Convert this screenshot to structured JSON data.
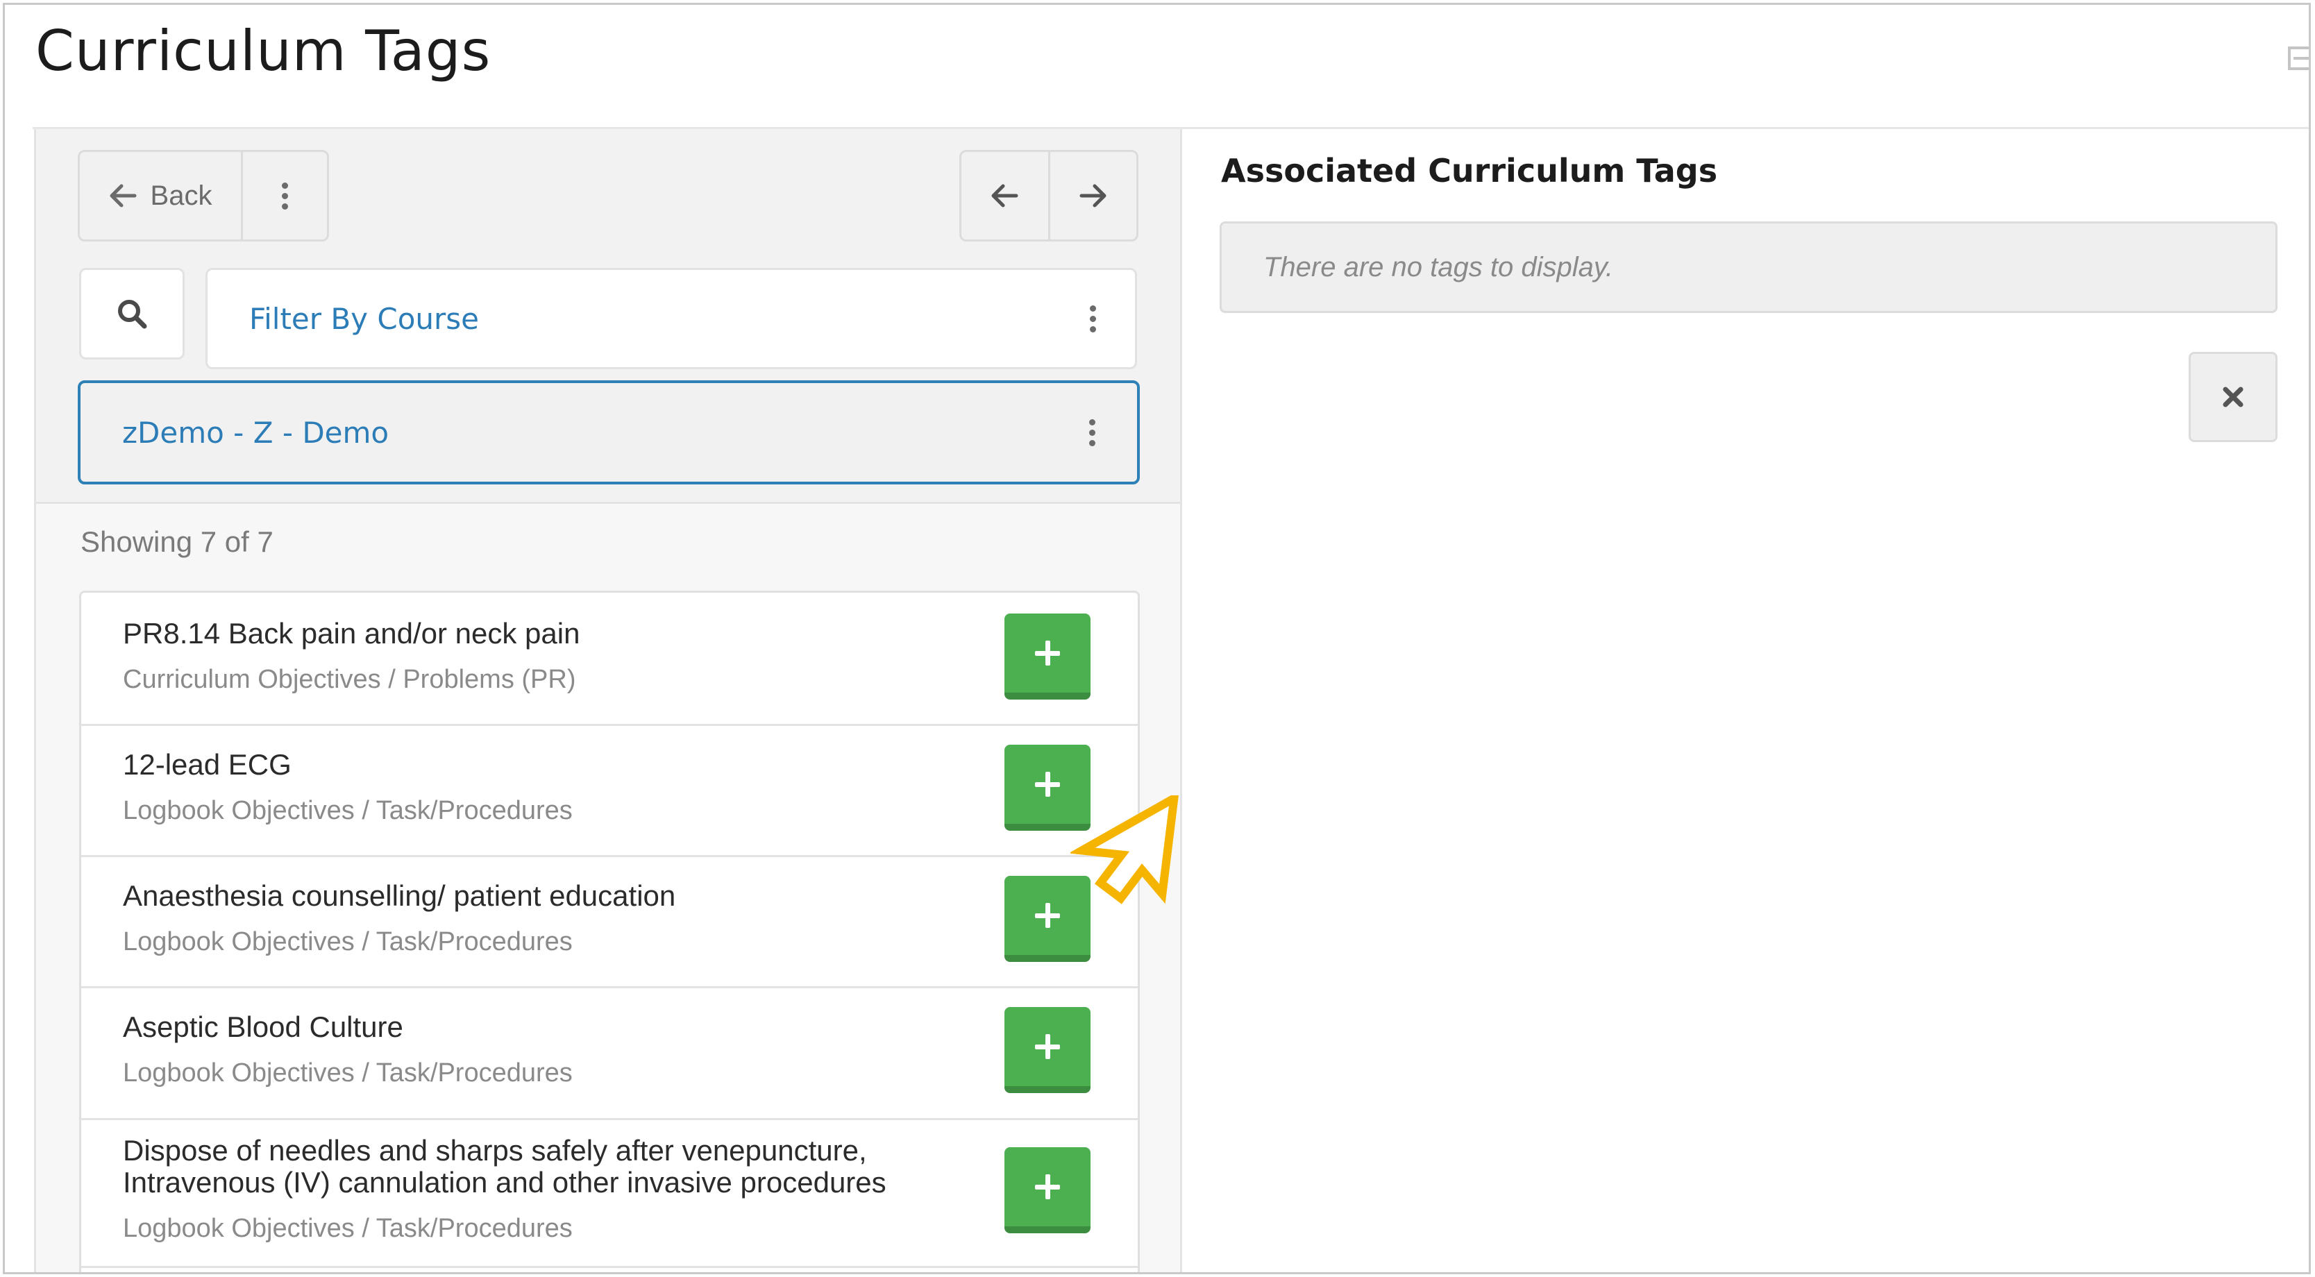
{
  "page": {
    "title": "Curriculum Tags"
  },
  "toolbar": {
    "back_label": "Back",
    "back_icon": "arrow-left-icon",
    "more_icon": "kebab-icon",
    "prev_icon": "arrow-left-icon",
    "next_icon": "arrow-right-icon"
  },
  "filters": {
    "search_icon": "search-icon",
    "filter_by_course_label": "Filter By Course",
    "selected_course": "zDemo - Z - Demo"
  },
  "list": {
    "showing_text": "Showing 7 of 7",
    "items": [
      {
        "title": "PR8.14 Back pain and/or neck pain",
        "category": "Curriculum Objectives / Problems (PR)"
      },
      {
        "title": "12-lead ECG",
        "category": "Logbook Objectives / Task/Procedures"
      },
      {
        "title": "Anaesthesia counselling/ patient education",
        "category": "Logbook Objectives / Task/Procedures"
      },
      {
        "title": "Aseptic Blood Culture",
        "category": "Logbook Objectives / Task/Procedures"
      },
      {
        "title": "Dispose of needles and sharps safely after venepuncture, Intravenous (IV) cannulation and other invasive procedures",
        "category": "Logbook Objectives / Task/Procedures"
      }
    ]
  },
  "associated": {
    "title": "Associated Curriculum Tags",
    "empty_message": "There are no tags to display."
  },
  "colors": {
    "accent_blue": "#2e81b6",
    "add_green": "#4caf50",
    "highlight_arrow": "#f5b400"
  }
}
